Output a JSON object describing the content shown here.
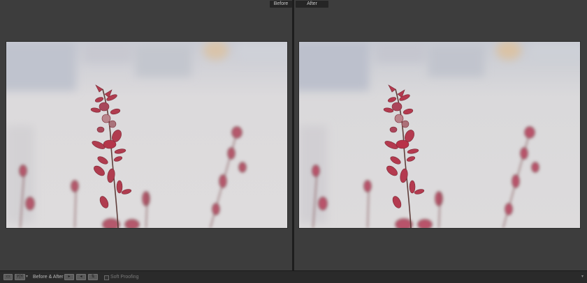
{
  "view_labels": {
    "before": "Before",
    "after": "After"
  },
  "photo": {
    "subject": "red-leaf-branch-on-blurred-background"
  },
  "toolbar": {
    "loupe_icon": "loupe-view-icon",
    "compare_label": "Y|Y",
    "before_after_label": "Before & After :",
    "copy_before_to_after_icon": "copy-left-to-right-icon",
    "copy_after_to_before_icon": "copy-right-to-left-icon",
    "swap_icon": "swap-before-after-icon",
    "soft_proofing_label": "Soft Proofing",
    "soft_proofing_checked": false
  }
}
